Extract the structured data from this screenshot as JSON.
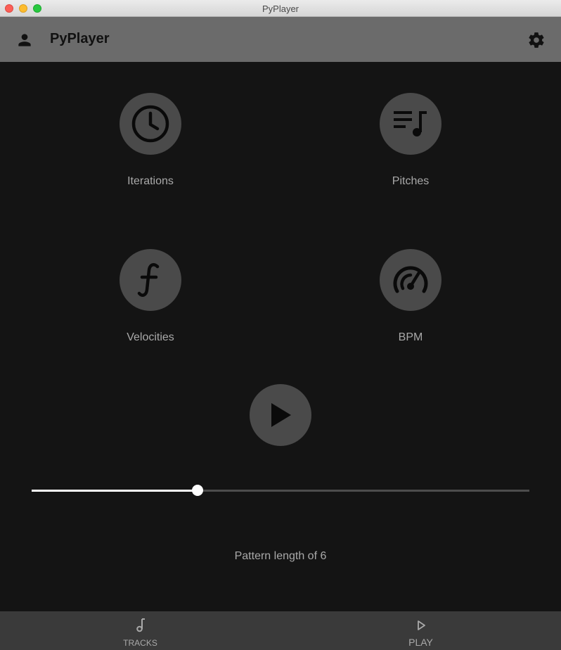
{
  "window": {
    "title": "PyPlayer"
  },
  "appbar": {
    "title": "PyPlayer",
    "user_icon": "person-icon",
    "settings_icon": "gear-icon"
  },
  "tiles": [
    {
      "label": "Iterations",
      "icon": "clock-icon"
    },
    {
      "label": "Pitches",
      "icon": "playlist-music-icon"
    },
    {
      "label": "Velocities",
      "icon": "function-f-icon"
    },
    {
      "label": "BPM",
      "icon": "speedometer-icon"
    }
  ],
  "player": {
    "play_icon": "play-icon"
  },
  "slider": {
    "value_fraction": 0.333
  },
  "pattern": {
    "text": "Pattern length of 6"
  },
  "bottom_nav": [
    {
      "label": "TRACKS",
      "icon": "music-note-icon"
    },
    {
      "label": "PLAY",
      "icon": "play-outline-icon"
    }
  ],
  "colors": {
    "background": "#141414",
    "appbar": "#6b6b6b",
    "circle": "#4a4a4a",
    "label": "#a9a9a9",
    "bottom_nav": "#3a3a3a"
  }
}
